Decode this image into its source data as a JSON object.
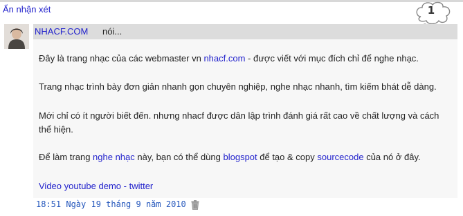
{
  "hide_link": "Ẩn nhận xét",
  "comment_count": "1",
  "comment": {
    "author": "NHACF.COM",
    "says": "nói...",
    "p1": {
      "a": "Đây là trang nhạc của các webmaster vn ",
      "link": "nhacf.com",
      "b": " - được viết với mục đích chỉ để nghe nhạc."
    },
    "p2": "Trang nhạc trình bày đơn giản nhanh gọn chuyên nghiệp, nghe nhạc nhanh, tìm kiếm bhát dễ dàng.",
    "p3": "Mới chỉ có ít người biết đến. nhưng nhacf được dân lập trình đánh giá rất cao về chất lượng và cách thể hiện.",
    "p4": {
      "a": "Để làm trang ",
      "link1": "nghe nhạc",
      "b": " này, bạn có thể dùng ",
      "link2": "blogspot",
      "c": " để tạo & copy ",
      "link3": "sourcecode",
      "d": " của nó ở đây."
    },
    "p5": {
      "link1": "Video youtube demo",
      "sep": " - ",
      "link2": "twitter"
    },
    "timestamp": "18:51 Ngày 19 tháng 9 năm 2010"
  },
  "icons": {
    "trash": "trash-icon",
    "bubble": "thought-bubble-icon"
  }
}
